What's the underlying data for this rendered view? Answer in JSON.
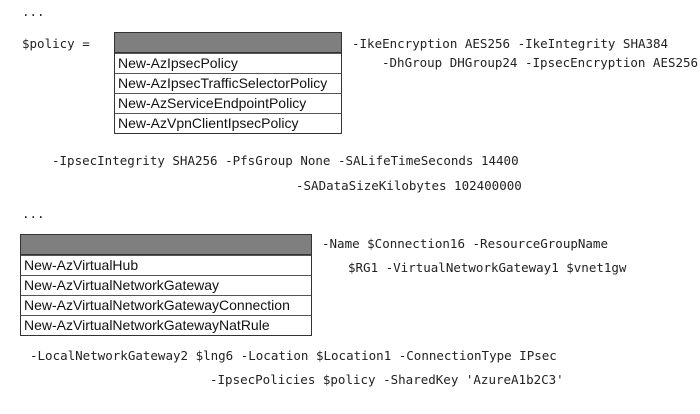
{
  "ellipsis_1": "...",
  "ellipsis_2": "...",
  "block1": {
    "label": "$policy =",
    "dropdown_options": [
      "New-AzIpsecPolicy",
      "New-AzIpsecTrafficSelectorPolicy",
      "New-AzServiceEndpointPolicy",
      "New-AzVpnClientIpsecPolicy"
    ],
    "line1": "-IkeEncryption AES256 -IkeIntegrity SHA384",
    "line2": "-DhGroup DHGroup24 -IpsecEncryption AES256",
    "line3": "-IpsecIntegrity SHA256 -PfsGroup None -SALifeTimeSeconds 14400",
    "line4": "-SADataSizeKilobytes 102400000"
  },
  "block2": {
    "dropdown_options": [
      "New-AzVirtualHub",
      "New-AzVirtualNetworkGateway",
      "New-AzVirtualNetworkGatewayConnection",
      "New-AzVirtualNetworkGatewayNatRule"
    ],
    "line1": "-Name $Connection16 -ResourceGroupName",
    "line2": "$RG1 -VirtualNetworkGateway1 $vnet1gw",
    "line3": "-LocalNetworkGateway2 $lng6 -Location $Location1 -ConnectionType IPsec",
    "line4": "-IpsecPolicies $policy -SharedKey 'AzureA1b2C3'"
  }
}
